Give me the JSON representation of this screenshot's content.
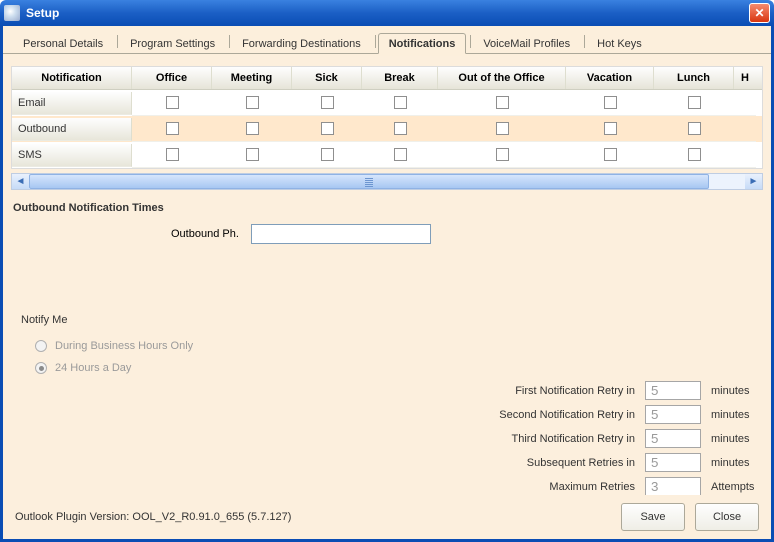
{
  "window": {
    "title": "Setup"
  },
  "tabs": {
    "items": [
      "Personal Details",
      "Program Settings",
      "Forwarding Destinations",
      "Notifications",
      "VoiceMail Profiles",
      "Hot Keys"
    ],
    "active_index": 3
  },
  "grid": {
    "columns": [
      "Notification",
      "Office",
      "Meeting",
      "Sick",
      "Break",
      "Out of the Office",
      "Vacation",
      "Lunch",
      "H"
    ],
    "rows": [
      {
        "label": "Email",
        "checks": [
          false,
          false,
          false,
          false,
          false,
          false,
          false
        ]
      },
      {
        "label": "Outbound",
        "checks": [
          false,
          false,
          false,
          false,
          false,
          false,
          false
        ]
      },
      {
        "label": "SMS",
        "checks": [
          false,
          false,
          false,
          false,
          false,
          false,
          false
        ]
      }
    ]
  },
  "outbound_section": {
    "title": "Outbound Notification Times",
    "phone_label": "Outbound Ph.",
    "phone_value": ""
  },
  "notify": {
    "heading": "Notify Me",
    "options": [
      {
        "label": "During Business Hours Only",
        "selected": false
      },
      {
        "label": "24 Hours a Day",
        "selected": true
      }
    ]
  },
  "retries": {
    "items": [
      {
        "label": "First Notification Retry in",
        "value": "5",
        "unit": "minutes"
      },
      {
        "label": "Second Notification Retry in",
        "value": "5",
        "unit": "minutes"
      },
      {
        "label": "Third Notification Retry in",
        "value": "5",
        "unit": "minutes"
      },
      {
        "label": "Subsequent Retries in",
        "value": "5",
        "unit": "minutes"
      },
      {
        "label": "Maximum Retries",
        "value": "3",
        "unit": "Attempts"
      }
    ]
  },
  "footer": {
    "version": "Outlook Plugin Version: OOL_V2_R0.91.0_655 (5.7.127)",
    "save": "Save",
    "close": "Close"
  }
}
